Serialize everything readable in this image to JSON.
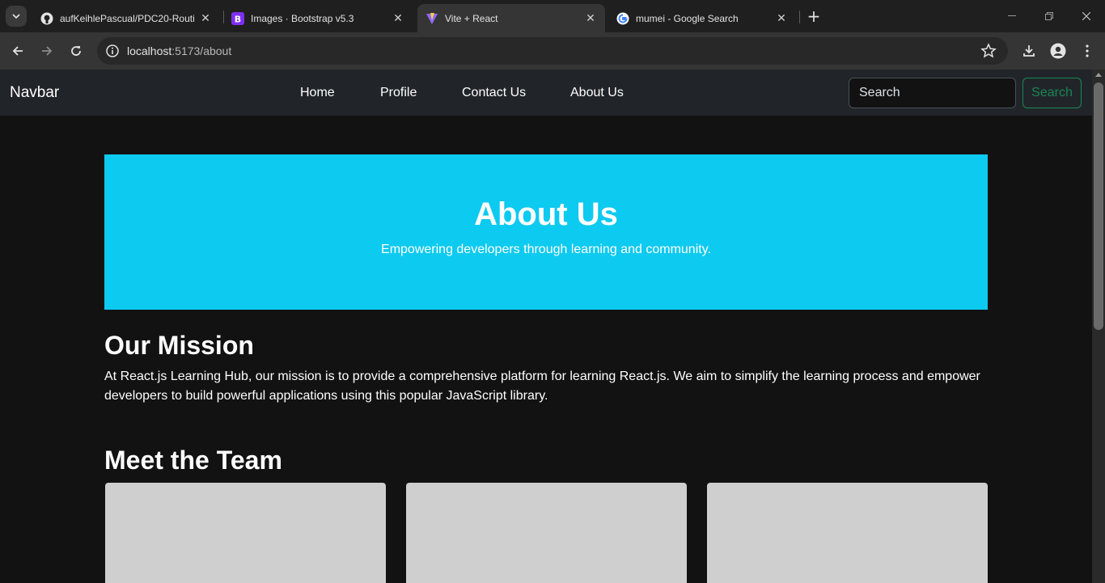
{
  "browser": {
    "tabs": [
      {
        "title": "aufKeihlePascual/PDC20-Routing",
        "favicon": "github-icon",
        "active": false
      },
      {
        "title": "Images · Bootstrap v5.3",
        "favicon": "bootstrap-icon",
        "active": false
      },
      {
        "title": "Vite + React",
        "favicon": "vite-icon",
        "active": true
      },
      {
        "title": "mumei - Google Search",
        "favicon": "google-icon",
        "active": false
      }
    ],
    "url_host": "localhost",
    "url_path": ":5173/about"
  },
  "navbar": {
    "brand": "Navbar",
    "links": [
      "Home",
      "Profile",
      "Contact Us",
      "About Us"
    ],
    "search_placeholder": "Search",
    "search_button": "Search"
  },
  "hero": {
    "title": "About Us",
    "subtitle": "Empowering developers through learning and community."
  },
  "mission": {
    "heading": "Our Mission",
    "text": "At React.js Learning Hub, our mission is to provide a comprehensive platform for learning React.js. We aim to simplify the learning process and empower developers to build powerful applications using this popular JavaScript library."
  },
  "team": {
    "heading": "Meet the Team"
  },
  "colors": {
    "hero_bg": "#0dcaf0",
    "navbar_bg": "#212529",
    "success": "#198754",
    "page_bg": "#121212"
  }
}
